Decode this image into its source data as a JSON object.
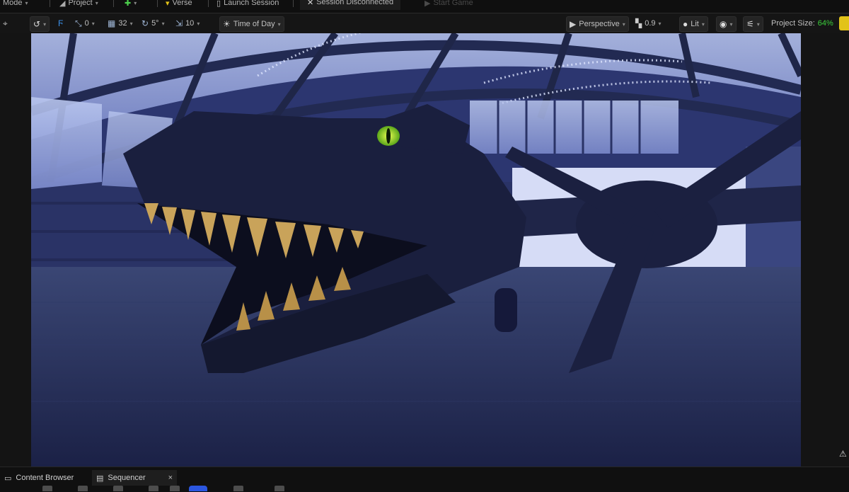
{
  "menubar": {
    "mode_label": "Mode",
    "project_label": "Project",
    "verse_label": "Verse",
    "launch_session_label": "Launch Session",
    "session_status_label": "Session Disconnected",
    "start_game_label": "Start Game"
  },
  "viewport_toolbar": {
    "grid_snap_value": "0",
    "grid_size_value": "32",
    "rotation_snap_value": "5°",
    "scale_snap_value": "10",
    "time_of_day_label": "Time of Day",
    "perspective_label": "Perspective",
    "camera_speed_value": "0.9",
    "view_mode_label": "Lit",
    "project_size_label": "Project Size:",
    "project_size_value": "64%",
    "project_size_color": "#3cd03c"
  },
  "bottom_tabs": {
    "content_browser_label": "Content Browser",
    "sequencer_label": "Sequencer",
    "close_symbol": "×"
  },
  "icons": [
    "transform-icon",
    "surface-snap-icon",
    "grid-snap-icon",
    "rotation-snap-icon",
    "scale-snap-icon",
    "sun-icon",
    "camera-icon",
    "speed-icon",
    "lit-sphere-icon",
    "eye-icon",
    "settings-icon",
    "warning-icon",
    "folder-icon",
    "clapper-icon"
  ]
}
